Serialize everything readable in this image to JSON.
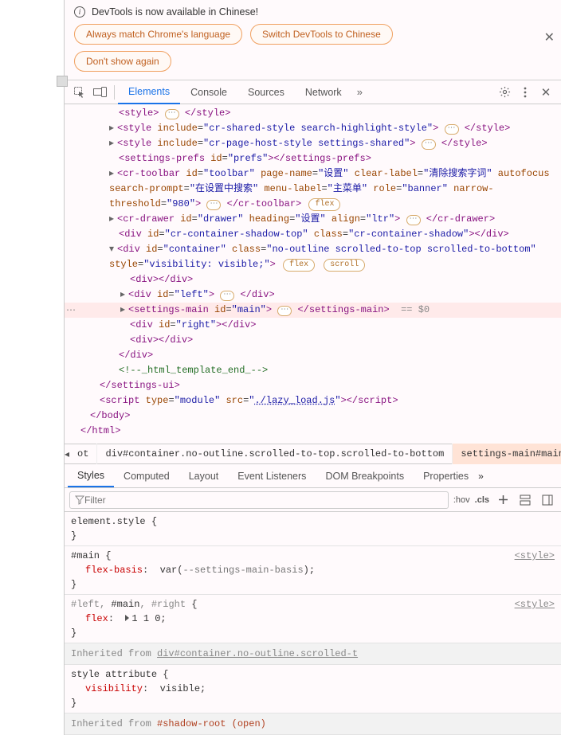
{
  "infobar": {
    "title": "DevTools is now available in Chinese!",
    "btn_always": "Always match Chrome's language",
    "btn_switch": "Switch DevTools to Chinese",
    "btn_dont": "Don't show again"
  },
  "tabs": {
    "elements": "Elements",
    "console": "Console",
    "sources": "Sources",
    "network": "Network"
  },
  "dom": {
    "l0": {
      "pre": "<",
      "tag": "style",
      "post": ">",
      "close": "</style>"
    },
    "l1": {
      "tag": "style",
      "a1n": "include",
      "a1v": "cr-shared-style search-highlight-style",
      "close": "</style>"
    },
    "l2": {
      "tag": "style",
      "a1n": "include",
      "a1v": "cr-page-host-style settings-shared",
      "close": "</style>"
    },
    "l3": {
      "tag": "settings-prefs",
      "a1n": "id",
      "a1v": "prefs",
      "close": "</settings-prefs>"
    },
    "l4": {
      "tag": "cr-toolbar",
      "idv": "toolbar",
      "pnn": "page-name",
      "pnv": "设置",
      "cln": "clear-label",
      "clv": "清除搜索字词",
      "afn": "autofocus",
      "spn": "search-prompt",
      "spv": "在设置中搜索",
      "mln": "menu-label",
      "mlv": "主菜单",
      "rn": "role",
      "rv": "banner",
      "ntn": "narrow-threshold",
      "ntv": "980",
      "close": "</cr-toolbar>",
      "badge": "flex"
    },
    "l5": {
      "tag": "cr-drawer",
      "idv": "drawer",
      "hn": "heading",
      "hv": "设置",
      "an": "align",
      "av": "ltr",
      "close": "</cr-drawer>"
    },
    "l6": {
      "tag": "div",
      "idv": "cr-container-shadow-top",
      "cn": "class",
      "cv": "cr-container-shadow",
      "close": "</div>"
    },
    "l7": {
      "tag": "div",
      "idv": "container",
      "cn": "class",
      "cv": "no-outline scrolled-to-top scrolled-to-bottom",
      "sn": "style",
      "sv": "visibility: visible;",
      "b1": "flex",
      "b2": "scroll"
    },
    "l8": {
      "tag": "div",
      "close": "</div>"
    },
    "l9": {
      "tag": "div",
      "idv": "left",
      "close": "</div>"
    },
    "l10": {
      "tag": "settings-main",
      "idv": "main",
      "close": "</settings-main>",
      "hint": "== $0"
    },
    "l11": {
      "tag": "div",
      "idv": "right",
      "close": "</div>"
    },
    "l12": {
      "tag": "div",
      "close": "</div>"
    },
    "l13": {
      "close": "</div>"
    },
    "l14": {
      "cmt": "<!--_html_template_end_-->"
    },
    "l15": {
      "close": "</settings-ui>"
    },
    "l16": {
      "tag": "script",
      "tn": "type",
      "tv": "module",
      "sn": "src",
      "sv": "./lazy_load.js",
      "close": "</script>"
    },
    "l17": {
      "close": "</body>"
    },
    "l18": {
      "close": "</html>"
    }
  },
  "crumbs": {
    "c1": "ot",
    "c2": "div#container.no-outline.scrolled-to-top.scrolled-to-bottom",
    "c3": "settings-main#main"
  },
  "subtabs": {
    "styles": "Styles",
    "computed": "Computed",
    "layout": "Layout",
    "events": "Event Listeners",
    "dombp": "DOM Breakpoints",
    "props": "Properties"
  },
  "filter": {
    "placeholder": "Filter",
    "hov": ":hov",
    "cls": ".cls"
  },
  "rules": {
    "r1_sel": "element.style",
    "r2_sel": "#main",
    "r2_origin": "<style>",
    "r2_pn": "flex-basis",
    "r2_pv_pre": "var(",
    "r2_var": "--settings-main-basis",
    "r2_pv_post": ");",
    "r3_sel_g1": "#left, ",
    "r3_sel_m": "#main",
    "r3_sel_g2": ", #right",
    "r3_origin": "<style>",
    "r3_pn": "flex",
    "r3_pv": "1 1 0;",
    "inh1_pre": "Inherited from ",
    "inh1_link": "div#container.no-outline.scrolled-t",
    "r4_sel": "style attribute",
    "r4_pn": "visibility",
    "r4_pv": "visible;",
    "inh2_pre": "Inherited from ",
    "inh2_link": "#shadow-root (open)"
  }
}
